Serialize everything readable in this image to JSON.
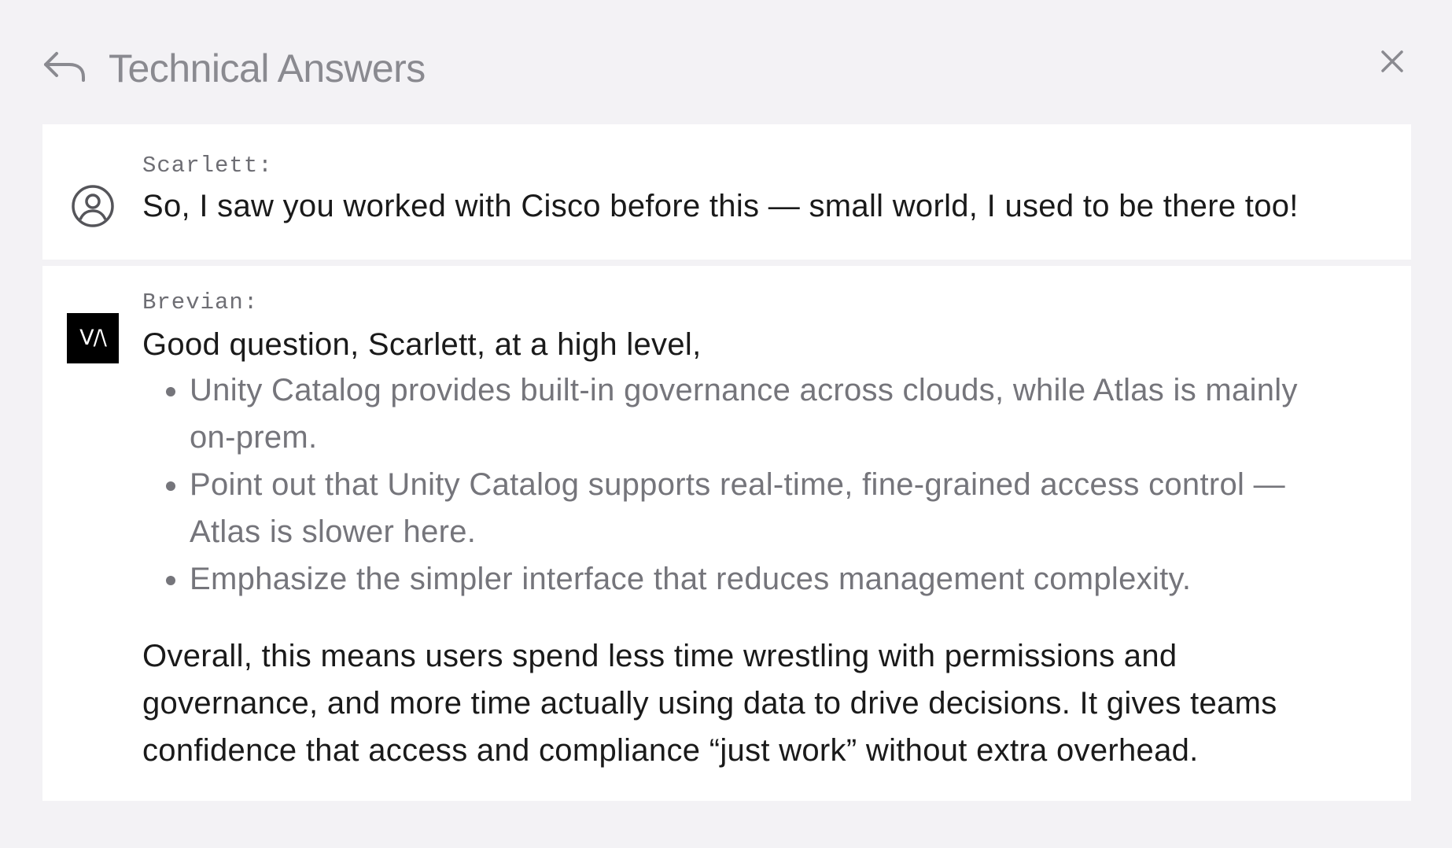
{
  "header": {
    "title": "Technical Answers",
    "back_icon": "back-arrow-icon",
    "close_icon": "close-icon"
  },
  "conversation": {
    "user_message": {
      "speaker": "Scarlett:",
      "avatar_icon": "user-avatar-icon",
      "text": "So, I saw you worked with Cisco before this — small world, I used to be there too!"
    },
    "bot_message": {
      "speaker": "Brevian:",
      "avatar_text": "V/\\",
      "intro": "Good question, Scarlett, at a high level,",
      "bullets": [
        "Unity Catalog provides built-in governance across clouds, while Atlas is mainly on-prem.",
        "Point out that Unity Catalog supports real-time, fine-grained access control — Atlas is slower here.",
        "Emphasize the simpler interface that reduces management complexity."
      ],
      "summary": "Overall, this means users spend less time wrestling with permissions and governance, and more time actually using data to drive decisions. It gives teams confidence that access and compliance “just work” without extra overhead."
    }
  },
  "colors": {
    "background": "#f3f2f5",
    "card": "#ffffff",
    "title_text": "#8a8a90",
    "primary_text": "#1a1a1a",
    "bullet_text": "#75757b",
    "avatar_bot_bg": "#000000"
  }
}
